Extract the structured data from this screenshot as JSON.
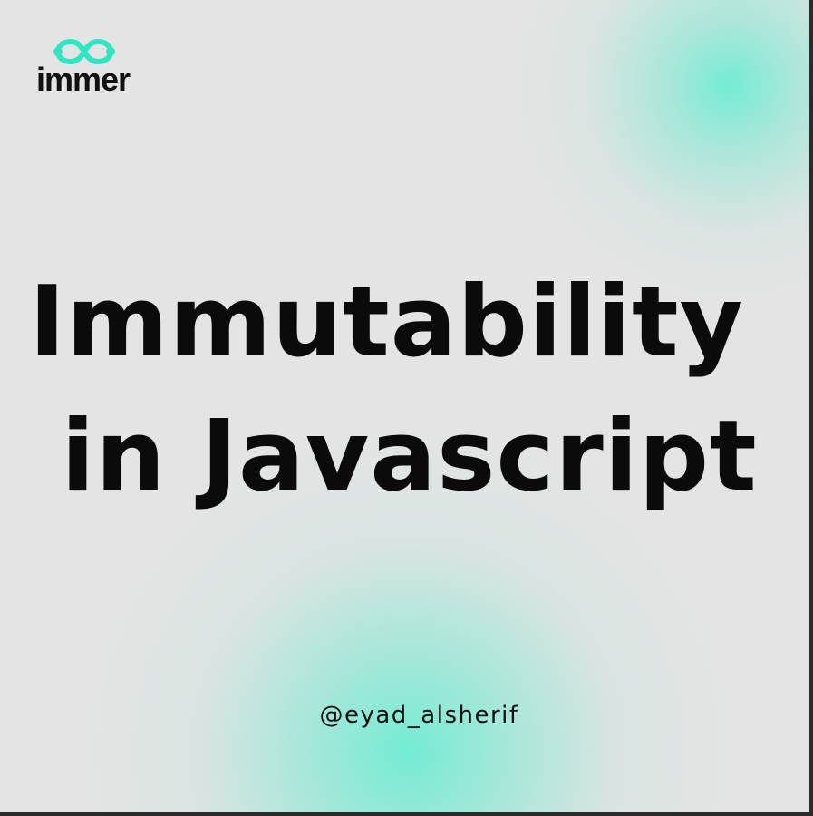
{
  "brand": {
    "name": "immer",
    "accent_color": "#2ee6c3",
    "icon": "infinity-logo-icon"
  },
  "title": {
    "line1": "Immutability",
    "line2": "in Javascript"
  },
  "author": {
    "handle": "@eyad_alsherif"
  },
  "colors": {
    "background": "#e4e4e4",
    "glow": "#7eecd8",
    "text": "#0b0b0b"
  }
}
